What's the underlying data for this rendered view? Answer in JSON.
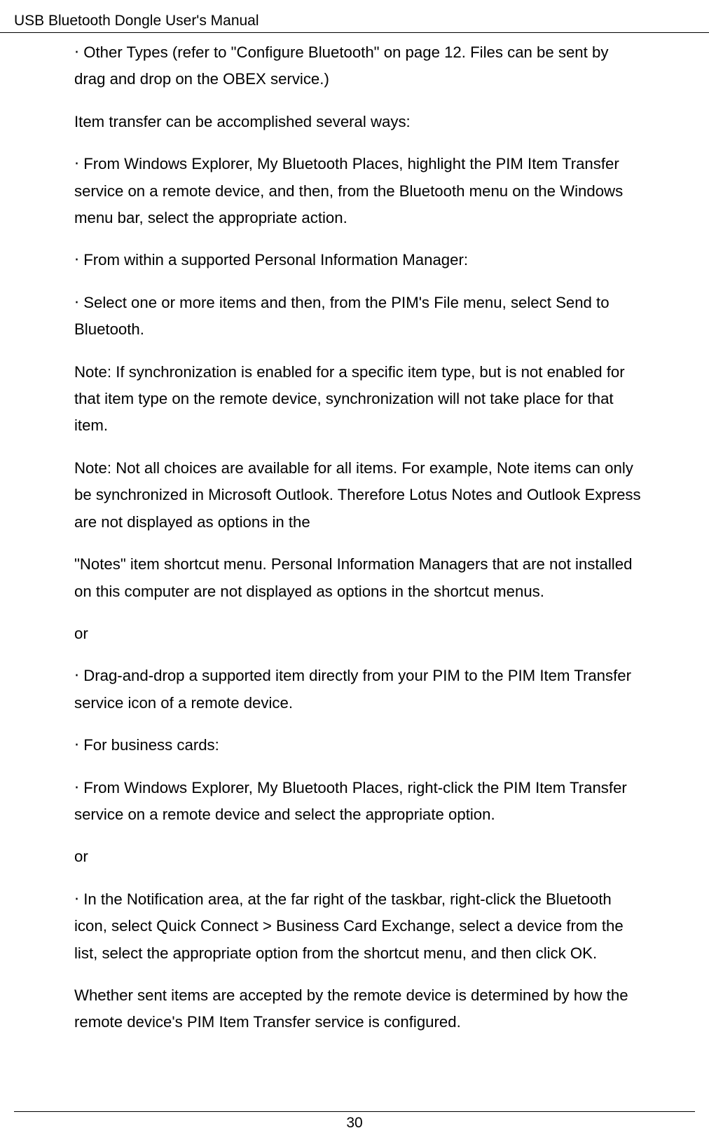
{
  "header": {
    "title": "USB Bluetooth Dongle User's Manual"
  },
  "paragraphs": {
    "p1": "‧  Other Types (refer to \"Configure Bluetooth\" on page 12. Files can be sent by drag and drop on the OBEX service.)",
    "p2": "Item transfer can be accomplished several ways:",
    "p3": "‧  From Windows Explorer, My Bluetooth Places, highlight the PIM Item Transfer service on a remote device, and then, from the Bluetooth menu on the Windows menu bar, select the appropriate action.",
    "p4": "‧  From within a supported Personal Information Manager:",
    "p5": "‧  Select one or more items and then, from the PIM's File menu, select Send to Bluetooth.",
    "p6": "Note: If synchronization is enabled for a specific item type, but is not enabled for that item type on the remote device, synchronization will not take place for that item.",
    "p7": "Note: Not all choices are available for all items. For example, Note items can only be synchronized in Microsoft Outlook. Therefore Lotus Notes and Outlook Express are not displayed as options in the",
    "p8": "  \"Notes\" item shortcut menu. Personal Information Managers that are not installed on this computer are not displayed as options in the shortcut menus.",
    "p9": "or",
    "p10": "‧  Drag-and-drop a supported item directly from your PIM to the PIM Item Transfer service icon of a remote device.",
    "p11": "‧  For business cards:",
    "p12": "‧  From Windows Explorer, My Bluetooth Places, right-click the PIM Item Transfer service on a remote device and select the appropriate option.",
    "p13": "or",
    "p14": "‧  In the Notification area, at the far right of the taskbar, right-click the Bluetooth icon, select Quick Connect > Business Card Exchange, select a device from the list, select the appropriate option from the shortcut menu, and then click OK.",
    "p15": "Whether sent items are accepted by the remote device is determined by how the remote device's PIM Item Transfer service is configured."
  },
  "footer": {
    "page_number": "30"
  }
}
